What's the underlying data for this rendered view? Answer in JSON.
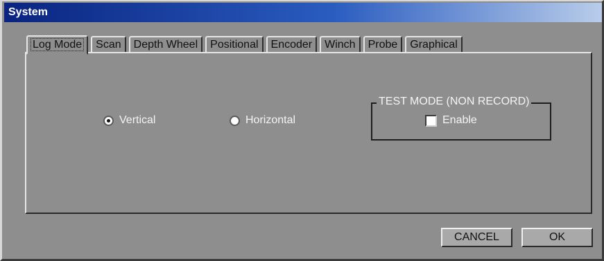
{
  "window": {
    "title": "System"
  },
  "tabs": [
    {
      "label": "Log Mode",
      "active": true
    },
    {
      "label": "Scan"
    },
    {
      "label": "Depth Wheel"
    },
    {
      "label": "Positional"
    },
    {
      "label": "Encoder"
    },
    {
      "label": "Winch"
    },
    {
      "label": "Probe"
    },
    {
      "label": "Graphical"
    }
  ],
  "log_mode": {
    "orientation": {
      "vertical_label": "Vertical",
      "horizontal_label": "Horizontal",
      "selected": "Vertical"
    },
    "test_mode": {
      "group_title": "TEST MODE (NON RECORD)",
      "enable_label": "Enable",
      "enabled": false
    }
  },
  "buttons": {
    "cancel_label": "CANCEL",
    "ok_label": "OK"
  },
  "colors": {
    "window_bg": "#8e8e8e",
    "titlebar_start": "#0a2480",
    "titlebar_end": "#b9cdea",
    "label_text": "#f4f4f4"
  }
}
